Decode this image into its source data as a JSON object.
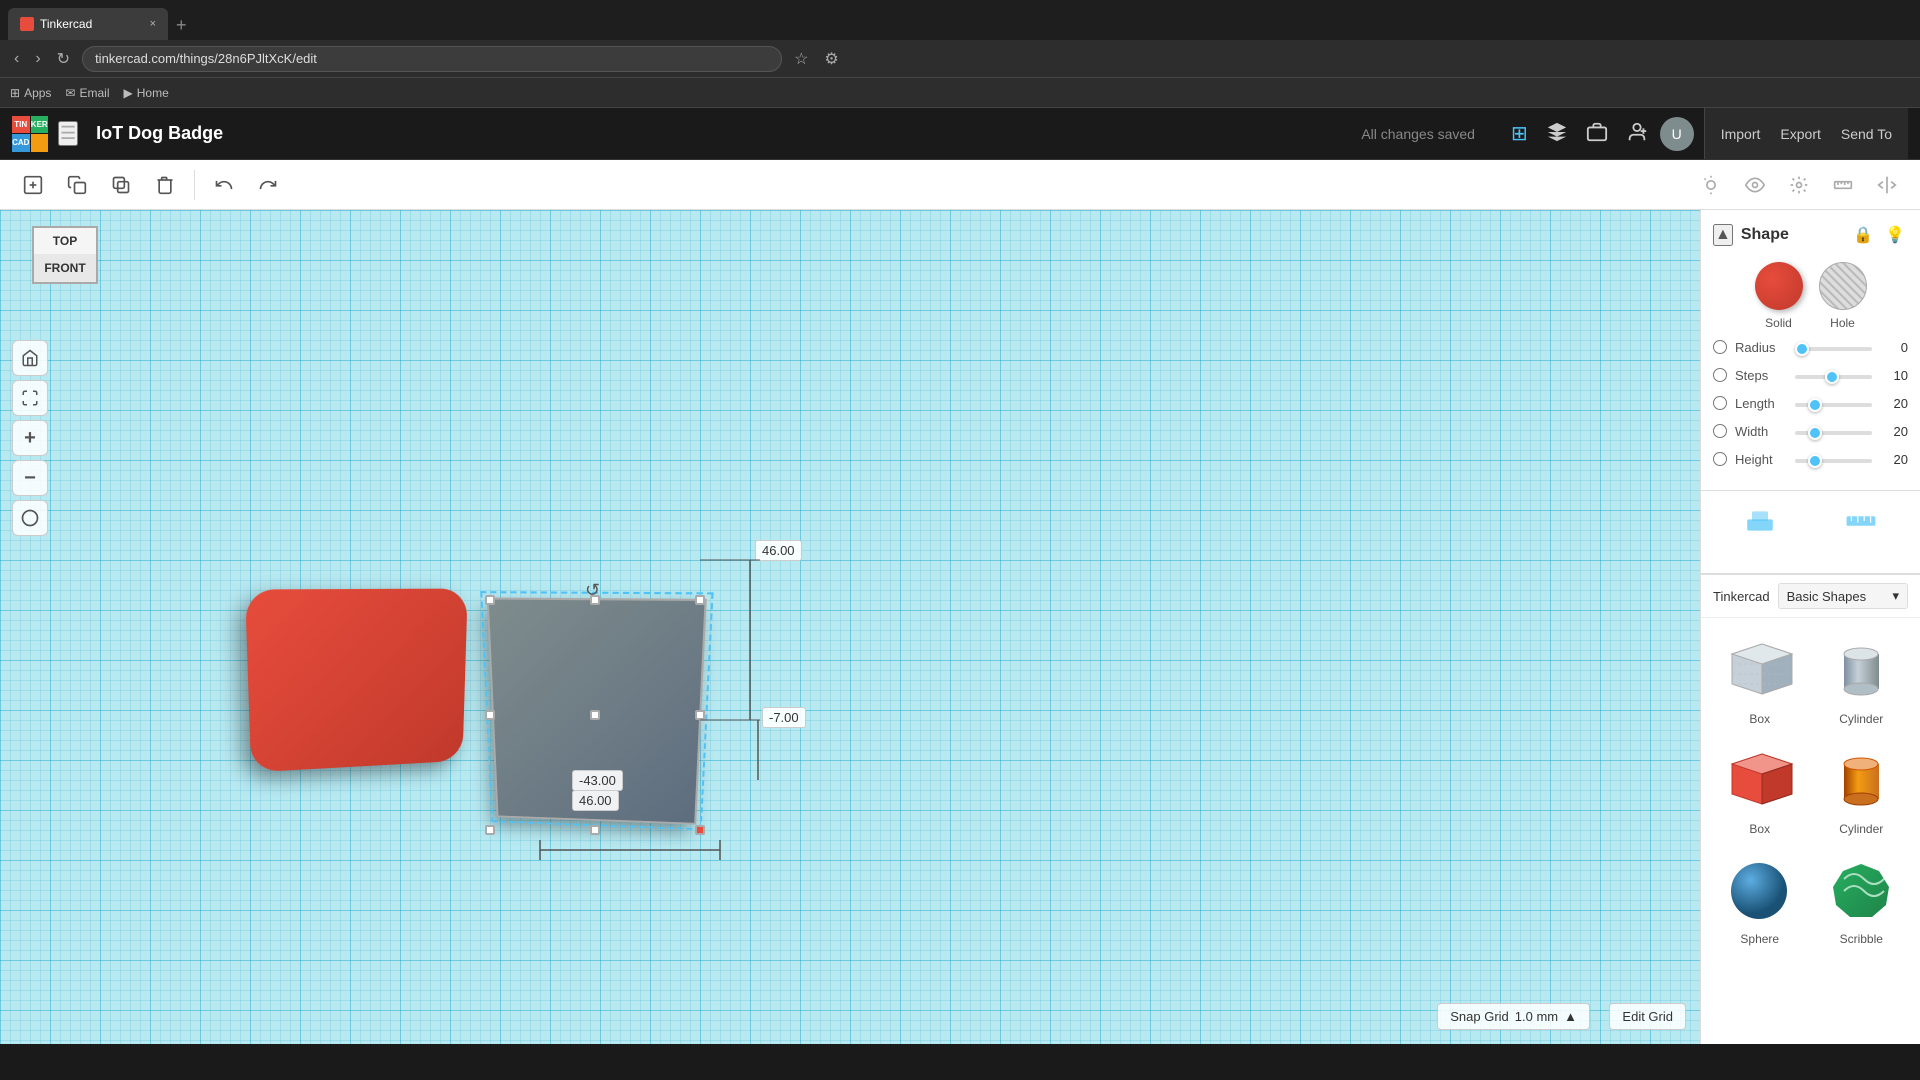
{
  "browser": {
    "url": "tinkercad.com/things/28n6PJltXcK/edit",
    "tab_title": "Tinkercad",
    "tab_close": "×",
    "nav": {
      "back": "‹",
      "forward": "›",
      "refresh": "↻",
      "apps_label": "Apps",
      "email_label": "Email",
      "home_label": "Home"
    }
  },
  "header": {
    "logo_cells": [
      "TIN",
      "KER",
      "CAD",
      ""
    ],
    "project_title": "IoT Dog Badge",
    "all_changes_saved": "All changes saved",
    "import_label": "Import",
    "export_label": "Export",
    "sendto_label": "Send To"
  },
  "toolbar": {
    "new_shape": "+",
    "copy": "⎘",
    "duplicate": "⧉",
    "delete": "⌫",
    "undo": "↩",
    "redo": "↪"
  },
  "view_cube": {
    "top_label": "TOP",
    "front_label": "FRONT"
  },
  "viewport": {
    "edit_grid_label": "Edit Grid",
    "snap_grid_label": "Snap Grid",
    "snap_grid_value": "1.0 mm"
  },
  "shape_panel": {
    "title": "Shape",
    "solid_label": "Solid",
    "hole_label": "Hole",
    "radius_label": "Radius",
    "radius_value": "0",
    "steps_label": "Steps",
    "steps_value": "10",
    "length_label": "Length",
    "length_value": "20",
    "width_label": "Width",
    "width_value": "20",
    "height_label": "Height",
    "height_value": "20"
  },
  "library": {
    "brand": "Tinkercad",
    "category": "Basic Shapes",
    "shapes": [
      {
        "name": "Box",
        "type": "box-grey"
      },
      {
        "name": "Cylinder",
        "type": "cyl-grey"
      },
      {
        "name": "Box",
        "type": "box-red"
      },
      {
        "name": "Cylinder",
        "type": "cyl-orange"
      },
      {
        "name": "Sphere",
        "type": "sphere-blue"
      },
      {
        "name": "Scribble",
        "type": "scribble-green"
      }
    ]
  },
  "workplane": {
    "workplane_label": "Workplane",
    "ruler_label": "Ruler"
  },
  "dimensions": {
    "side": "46.00",
    "neg7": "-7.00",
    "neg43": "-43.00",
    "bottom": "46.00"
  }
}
